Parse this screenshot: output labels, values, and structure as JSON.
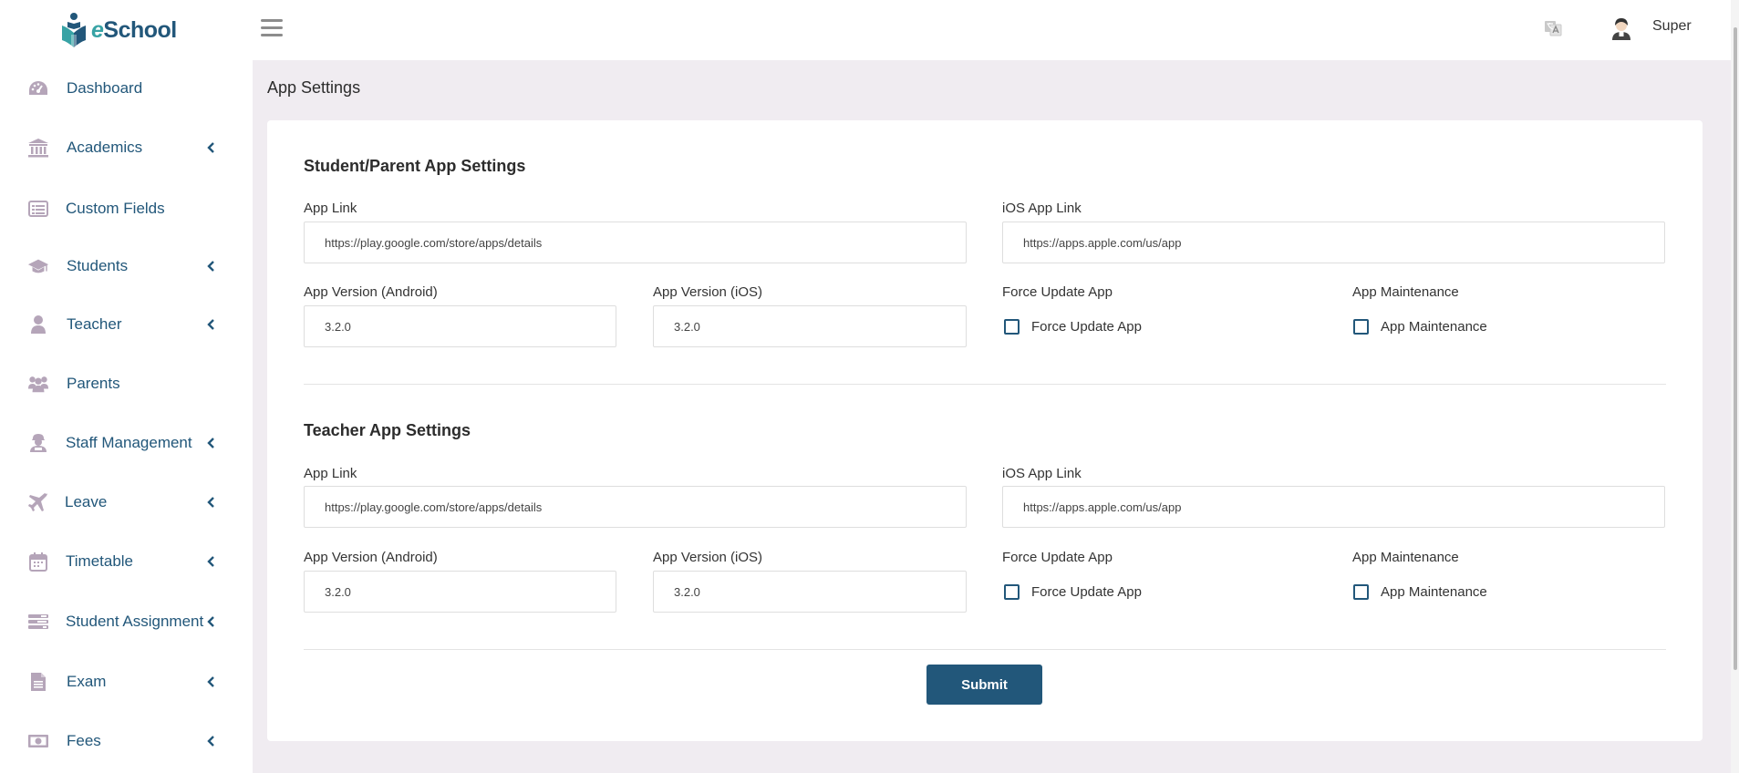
{
  "app": {
    "logo_text_prefix": "e",
    "logo_text_rest": "School"
  },
  "colors": {
    "primary": "#22577a",
    "accent": "#38a3a5",
    "icon_muted": "#b5a5b9",
    "page_bg": "#f0ecf1"
  },
  "sidebar": {
    "items": [
      {
        "label": "Dashboard",
        "icon": "dashboard-icon",
        "has_submenu": false
      },
      {
        "label": "Academics",
        "icon": "institution-icon",
        "has_submenu": true
      },
      {
        "label": "Custom Fields",
        "icon": "list-icon",
        "has_submenu": false
      },
      {
        "label": "Students",
        "icon": "graduation-cap-icon",
        "has_submenu": true
      },
      {
        "label": "Teacher",
        "icon": "user-icon",
        "has_submenu": true
      },
      {
        "label": "Parents",
        "icon": "users-icon",
        "has_submenu": false
      },
      {
        "label": "Staff Management",
        "icon": "user-secret-icon",
        "has_submenu": true
      },
      {
        "label": "Leave",
        "icon": "plane-icon",
        "has_submenu": true
      },
      {
        "label": "Timetable",
        "icon": "calendar-icon",
        "has_submenu": true
      },
      {
        "label": "Student Assignment",
        "icon": "tasks-icon",
        "has_submenu": true
      },
      {
        "label": "Exam",
        "icon": "file-icon",
        "has_submenu": true
      },
      {
        "label": "Fees",
        "icon": "money-icon",
        "has_submenu": true
      }
    ]
  },
  "topbar": {
    "user_name": "Super"
  },
  "page": {
    "title": "App Settings",
    "sections": [
      {
        "title": "Student/Parent App Settings",
        "app_link_label": "App Link",
        "app_link_value": "https://play.google.com/store/apps/details",
        "ios_link_label": "iOS App Link",
        "ios_link_value": "https://apps.apple.com/us/app",
        "android_version_label": "App Version (Android)",
        "android_version_value": "3.2.0",
        "ios_version_label": "App Version (iOS)",
        "ios_version_value": "3.2.0",
        "force_update_label": "Force Update App",
        "force_update_checkbox_label": "Force Update App",
        "force_update_checked": false,
        "maintenance_label": "App Maintenance",
        "maintenance_checkbox_label": "App Maintenance",
        "maintenance_checked": false
      },
      {
        "title": "Teacher App Settings",
        "app_link_label": "App Link",
        "app_link_value": "https://play.google.com/store/apps/details",
        "ios_link_label": "iOS App Link",
        "ios_link_value": "https://apps.apple.com/us/app",
        "android_version_label": "App Version (Android)",
        "android_version_value": "3.2.0",
        "ios_version_label": "App Version (iOS)",
        "ios_version_value": "3.2.0",
        "force_update_label": "Force Update App",
        "force_update_checkbox_label": "Force Update App",
        "force_update_checked": false,
        "maintenance_label": "App Maintenance",
        "maintenance_checkbox_label": "App Maintenance",
        "maintenance_checked": false
      }
    ],
    "submit_label": "Submit"
  }
}
